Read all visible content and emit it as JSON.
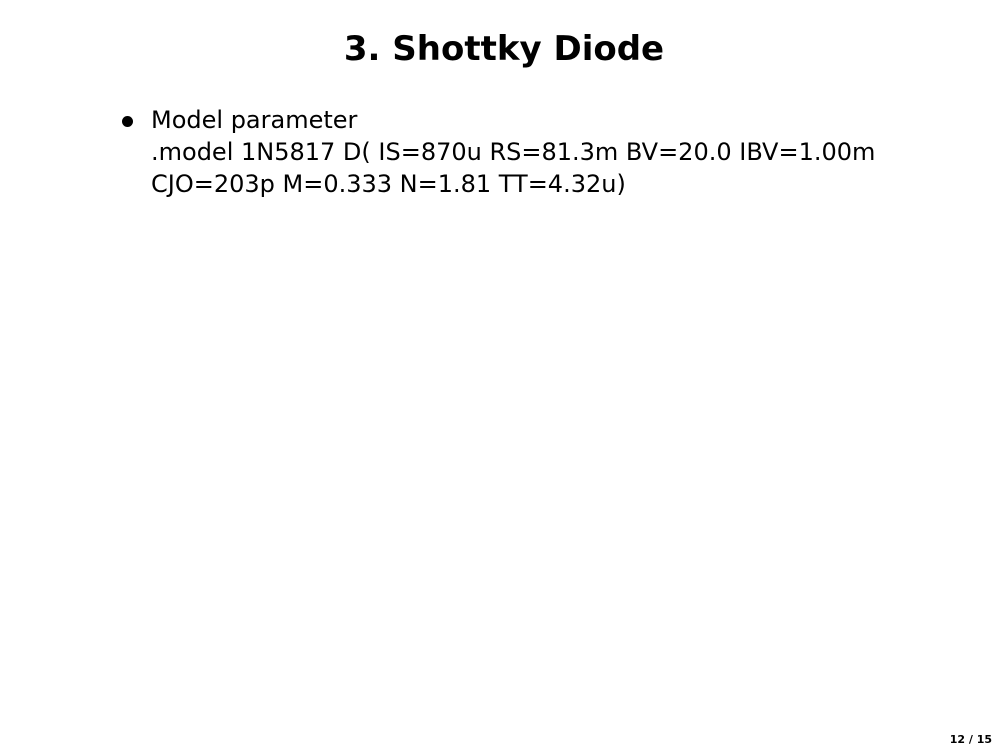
{
  "slide": {
    "title": "3. Shottky Diode",
    "bullets": [
      {
        "lines": [
          "Model parameter",
          ".model 1N5817 D( IS=870u RS=81.3m BV=20.0 IBV=1.00m",
          "CJO=203p M=0.333 N=1.81 TT=4.32u)"
        ]
      }
    ],
    "page_number": "12 / 15"
  }
}
